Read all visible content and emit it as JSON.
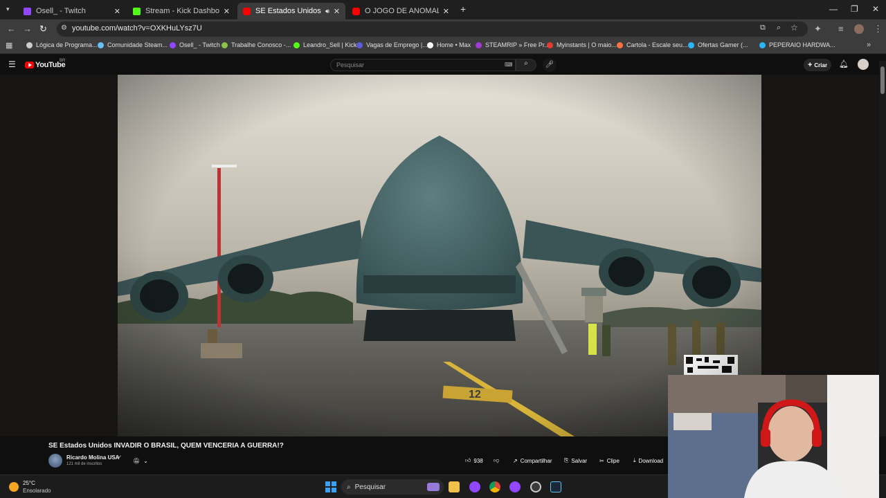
{
  "browser": {
    "tabs": [
      {
        "title": "Osell_ - Twitch",
        "color": "#9146ff"
      },
      {
        "title": "Stream - Kick Dashboard",
        "color": "#53fc18"
      },
      {
        "title": "SE Estados Unidos INVADIR",
        "color": "#ff0000"
      },
      {
        "title": "O JOGO DE ANOMALIAS MAIS",
        "color": "#ff0000"
      }
    ],
    "new_tab": "+",
    "url": "youtube.com/watch?v=OXKHuLYsz7U",
    "bookmarks": [
      {
        "label": "Lógica de Programa...",
        "color": "#cccccc"
      },
      {
        "label": "Comunidade Steam...",
        "color": "#66c0f4"
      },
      {
        "label": "Osell_ - Twitch",
        "color": "#9146ff"
      },
      {
        "label": "Trabalhe Conosco -...",
        "color": "#8bc34a"
      },
      {
        "label": "Leandro_Sell | Kick",
        "color": "#53fc18"
      },
      {
        "label": "Vagas de Emprego |...",
        "color": "#5b5bd6"
      },
      {
        "label": "Home • Max",
        "color": "#ffffff"
      },
      {
        "label": "STEAMRIP » Free Pr...",
        "color": "#a23bd6"
      },
      {
        "label": "Myinstants | O maio...",
        "color": "#e53935"
      },
      {
        "label": "Cartola - Escale seu...",
        "color": "#ff7043"
      },
      {
        "label": "Ofertas Gamer (...",
        "color": "#29b6f6"
      },
      {
        "label": "PEPERAIO HARDWA...",
        "color": "#29b6f6"
      }
    ]
  },
  "youtube": {
    "logo_text": "YouTube",
    "country": "BR",
    "search_placeholder": "Pesquisar",
    "create_label": "Criar"
  },
  "video": {
    "title": "SE Estados Unidos INVADIR O BRASIL, QUEM VENCERIA A GUERRA!?",
    "channel": "Ricardo Molina USA",
    "subscribers": "121 mil de inscritos",
    "likes": "938",
    "share_label": "Compartilhar",
    "save_label": "Salvar",
    "clip_label": "Clipe",
    "download_label": "Download",
    "runway_marking": "12"
  },
  "taskbar": {
    "weather_temp": "25°C",
    "weather_desc": "Ensolarado",
    "search_label": "Pesquisar"
  },
  "colors": {
    "youtube_red": "#ff0000",
    "sky": "#bdb7ab",
    "aircraft": "#3f5e60",
    "tarmac": "#4a4a45"
  }
}
